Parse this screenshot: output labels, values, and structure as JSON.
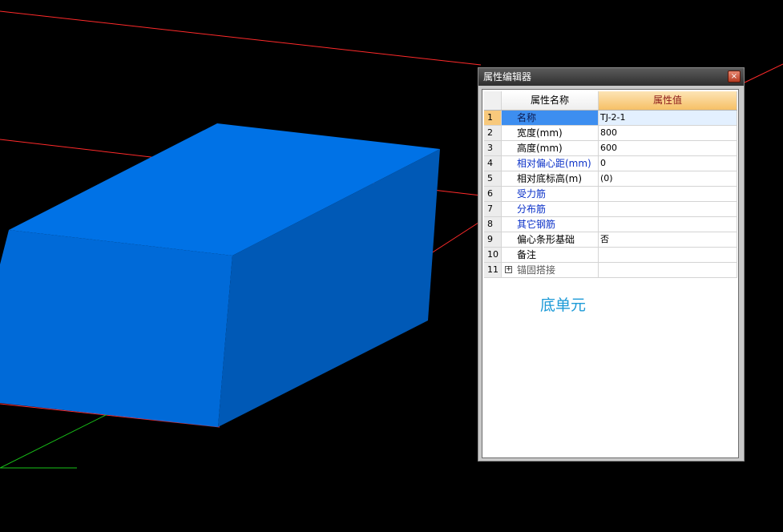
{
  "panel": {
    "title": "属性编辑器",
    "close_glyph": "×",
    "header": {
      "num": "",
      "name": "属性名称",
      "value": "属性值"
    },
    "rows": [
      {
        "num": "1",
        "name": "名称",
        "value": "TJ-2-1"
      },
      {
        "num": "2",
        "name": "宽度(mm)",
        "value": "800"
      },
      {
        "num": "3",
        "name": "高度(mm)",
        "value": "600"
      },
      {
        "num": "4",
        "name": "相对偏心距(mm)",
        "value": "0"
      },
      {
        "num": "5",
        "name": "相对底标高(m)",
        "value": "(0)"
      },
      {
        "num": "6",
        "name": "受力筋",
        "value": ""
      },
      {
        "num": "7",
        "name": "分布筋",
        "value": ""
      },
      {
        "num": "8",
        "name": "其它钢筋",
        "value": ""
      },
      {
        "num": "9",
        "name": "偏心条形基础",
        "value": "否"
      },
      {
        "num": "10",
        "name": "备注",
        "value": ""
      },
      {
        "num": "11",
        "name": "锚固搭接",
        "value": "",
        "expand_glyph": "+"
      }
    ]
  },
  "overlay_label": "底单元",
  "colors": {
    "viewport_background": "#000000",
    "block_top": "#0072e6",
    "block_front": "#006ad8",
    "block_side": "#0059b6",
    "axis_red": "#ff2a2a",
    "axis_green": "#18c418",
    "selected_row": "#3d8ef0",
    "header_value_bg": "#f6c066",
    "blue_text": "#0b31c8",
    "label_blue": "#1c9ad7"
  }
}
